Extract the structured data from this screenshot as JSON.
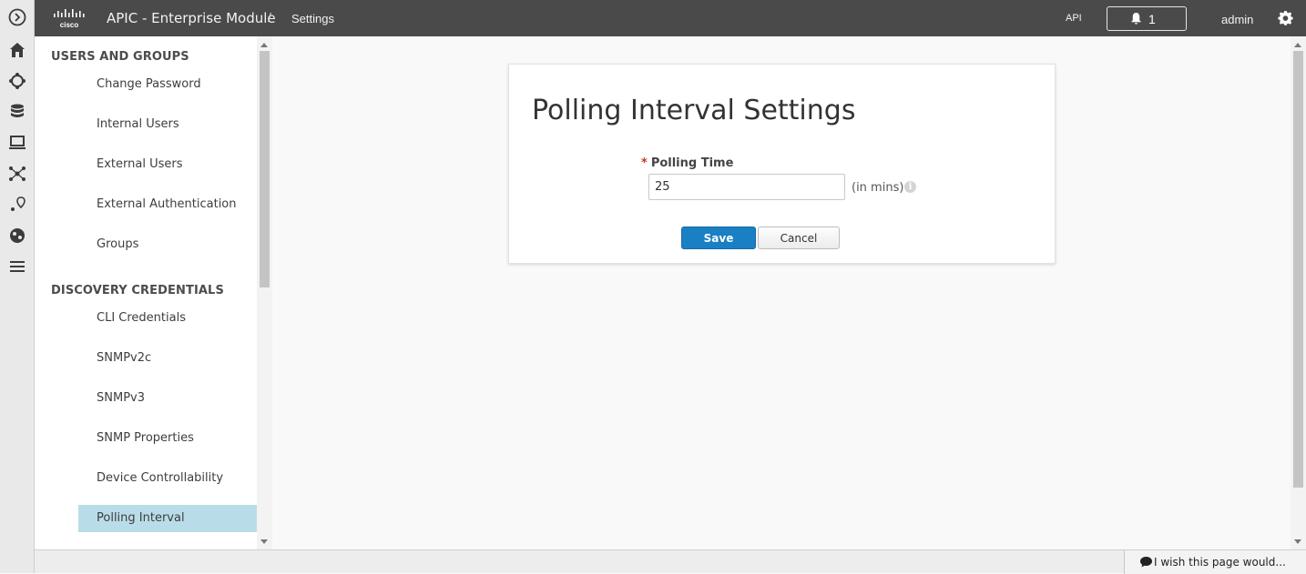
{
  "header": {
    "logo_text": "cisco",
    "app_title": "APIC - Enterprise Module",
    "separator": "/",
    "page": "Settings",
    "api_label": "API",
    "notification_count": "1",
    "user": "admin"
  },
  "rail": {
    "icons": [
      "expand-icon",
      "home-icon",
      "topology-icon",
      "database-icon",
      "device-icon",
      "network-icon",
      "location-icon",
      "dashboard-icon",
      "menu-icon"
    ]
  },
  "sidebar": {
    "sections": [
      {
        "title": "USERS AND GROUPS",
        "items": [
          "Change Password",
          "Internal Users",
          "External Users",
          "External Authentication",
          "Groups"
        ]
      },
      {
        "title": "DISCOVERY CREDENTIALS",
        "items": [
          "CLI Credentials",
          "SNMPv2c",
          "SNMPv3",
          "SNMP Properties",
          "Device Controllability",
          "Polling Interval"
        ]
      }
    ],
    "active": "Polling Interval"
  },
  "card": {
    "title": "Polling Interval Settings",
    "required_mark": "*",
    "field_label": "Polling Time",
    "field_value": "25",
    "unit": "(in mins)",
    "info_glyph": "i",
    "save_label": "Save",
    "cancel_label": "Cancel"
  },
  "footer": {
    "feedback_text": "I wish this page would..."
  },
  "colors": {
    "header_bg": "#4a4a4a",
    "accent": "#1b7fc4",
    "active_nav": "#b9dde8"
  }
}
